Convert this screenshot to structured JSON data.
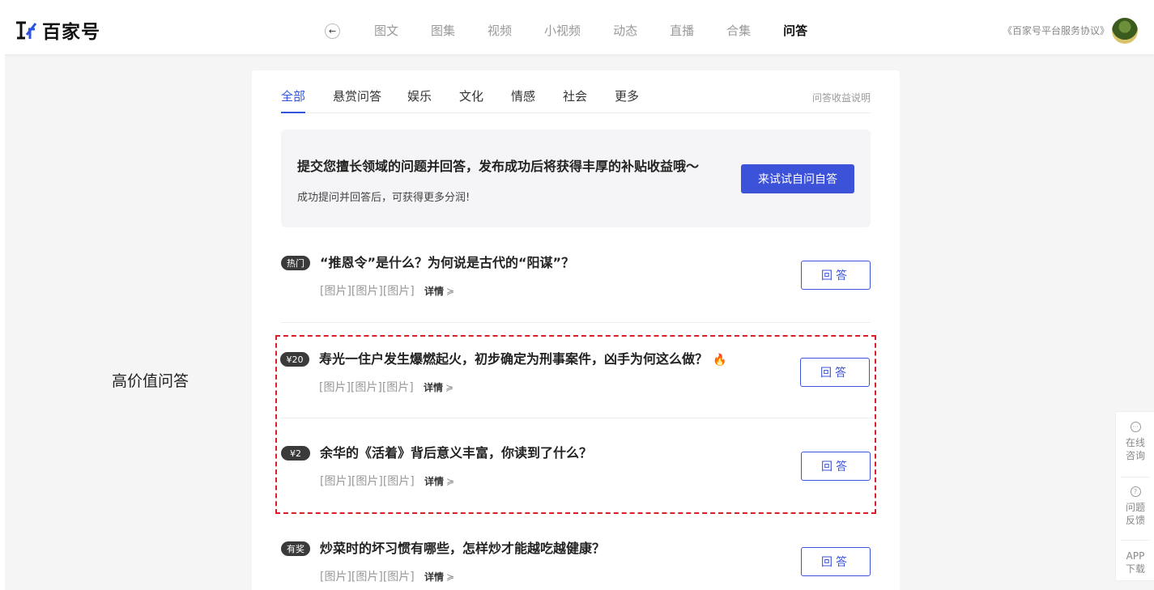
{
  "header": {
    "logo_text": "百家号",
    "back_icon": "arrow-left-icon",
    "nav": [
      "图文",
      "图集",
      "视频",
      "小视频",
      "动态",
      "直播",
      "合集",
      "问答"
    ],
    "active_nav": "问答",
    "agreement": "《百家号平台服务协议》"
  },
  "side_label": "高价值问答",
  "tabs": {
    "items": [
      "全部",
      "悬赏问答",
      "娱乐",
      "文化",
      "情感",
      "社会",
      "更多"
    ],
    "active": "全部",
    "link": "问答收益说明"
  },
  "banner": {
    "title": "提交您擅长领域的问题并回答，发布成功后将获得丰厚的补贴收益哦～",
    "subtitle": "成功提问并回答后，可获得更多分润!",
    "button": "来试试自问自答"
  },
  "questions": [
    {
      "badge": "热门",
      "title": "“推恩令”是什么？为何说是古代的“阳谋”？",
      "desc": "[图片][图片][图片]",
      "detail": "详情",
      "answer": "回答",
      "hot": false
    },
    {
      "badge": "¥20",
      "title": "寿光一住户发生爆燃起火，初步确定为刑事案件，凶手为何这么做？",
      "desc": "[图片][图片][图片]",
      "detail": "详情",
      "answer": "回答",
      "hot": true
    },
    {
      "badge": "¥2",
      "title": "余华的《活着》背后意义丰富，你读到了什么？",
      "desc": "[图片][图片][图片]",
      "detail": "详情",
      "answer": "回答",
      "hot": false
    },
    {
      "badge": "有奖",
      "title": "炒菜时的坏习惯有哪些，怎样炒才能越吃越健康？",
      "desc": "[图片][图片][图片]",
      "detail": "详情",
      "answer": "回答",
      "hot": false
    }
  ],
  "float_panel": [
    {
      "icon": "chat-bubble-icon",
      "label1": "在线",
      "label2": "咨询"
    },
    {
      "icon": "question-circle-icon",
      "label1": "问题",
      "label2": "反馈"
    },
    {
      "icon": "",
      "label1": "APP",
      "label2": "下载"
    }
  ],
  "colors": {
    "accent": "#3c52d9",
    "highlight_border": "#d9202a",
    "badge_bg": "#3a3a3a"
  }
}
